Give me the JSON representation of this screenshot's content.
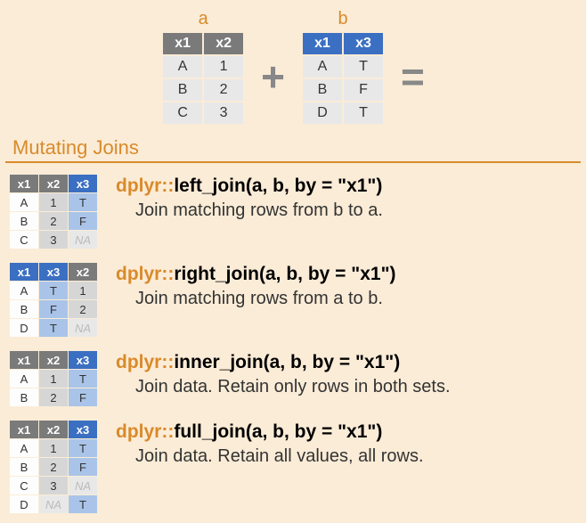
{
  "header": {
    "label_a": "a",
    "label_b": "b",
    "plus": "+",
    "equals": "=",
    "table_a": {
      "cols": [
        "x1",
        "x2"
      ],
      "rows": [
        [
          "A",
          "1"
        ],
        [
          "B",
          "2"
        ],
        [
          "C",
          "3"
        ]
      ]
    },
    "table_b": {
      "cols": [
        "x1",
        "x3"
      ],
      "rows": [
        [
          "A",
          "T"
        ],
        [
          "B",
          "F"
        ],
        [
          "D",
          "T"
        ]
      ]
    }
  },
  "section_title": "Mutating Joins",
  "joins": [
    {
      "pkg": "dplyr::",
      "sig": "left_join(a, b, by = \"x1\")",
      "desc": "Join matching rows from b to a.",
      "table": {
        "cols": [
          "x1",
          "x2",
          "x3"
        ],
        "col_styles": [
          "gray",
          "gray",
          "blue"
        ],
        "rows": [
          [
            [
              "A",
              "white"
            ],
            [
              "1",
              "gray"
            ],
            [
              "T",
              "blue"
            ]
          ],
          [
            [
              "B",
              "white"
            ],
            [
              "2",
              "gray"
            ],
            [
              "F",
              "blue"
            ]
          ],
          [
            [
              "C",
              "white"
            ],
            [
              "3",
              "gray"
            ],
            [
              "NA",
              "na"
            ]
          ]
        ]
      }
    },
    {
      "pkg": "dplyr::",
      "sig": "right_join(a, b, by = \"x1\")",
      "desc": "Join matching rows from a to b.",
      "table": {
        "cols": [
          "x1",
          "x3",
          "x2"
        ],
        "col_styles": [
          "blue",
          "blue",
          "gray"
        ],
        "rows": [
          [
            [
              "A",
              "white"
            ],
            [
              "T",
              "blue"
            ],
            [
              "1",
              "gray"
            ]
          ],
          [
            [
              "B",
              "white"
            ],
            [
              "F",
              "blue"
            ],
            [
              "2",
              "gray"
            ]
          ],
          [
            [
              "D",
              "white"
            ],
            [
              "T",
              "blue"
            ],
            [
              "NA",
              "na"
            ]
          ]
        ]
      }
    },
    {
      "pkg": "dplyr::",
      "sig": "inner_join(a, b, by = \"x1\")",
      "desc": "Join data. Retain only rows in both sets.",
      "table": {
        "cols": [
          "x1",
          "x2",
          "x3"
        ],
        "col_styles": [
          "gray",
          "gray",
          "blue"
        ],
        "rows": [
          [
            [
              "A",
              "white"
            ],
            [
              "1",
              "gray"
            ],
            [
              "T",
              "blue"
            ]
          ],
          [
            [
              "B",
              "white"
            ],
            [
              "2",
              "gray"
            ],
            [
              "F",
              "blue"
            ]
          ]
        ]
      }
    },
    {
      "pkg": "dplyr::",
      "sig": "full_join(a, b, by = \"x1\")",
      "desc": "Join data. Retain all values, all rows.",
      "table": {
        "cols": [
          "x1",
          "x2",
          "x3"
        ],
        "col_styles": [
          "gray",
          "gray",
          "blue"
        ],
        "rows": [
          [
            [
              "A",
              "white"
            ],
            [
              "1",
              "gray"
            ],
            [
              "T",
              "blue"
            ]
          ],
          [
            [
              "B",
              "white"
            ],
            [
              "2",
              "gray"
            ],
            [
              "F",
              "blue"
            ]
          ],
          [
            [
              "C",
              "white"
            ],
            [
              "3",
              "gray"
            ],
            [
              "NA",
              "na"
            ]
          ],
          [
            [
              "D",
              "white"
            ],
            [
              "NA",
              "na"
            ],
            [
              "T",
              "blue"
            ]
          ]
        ]
      }
    }
  ]
}
